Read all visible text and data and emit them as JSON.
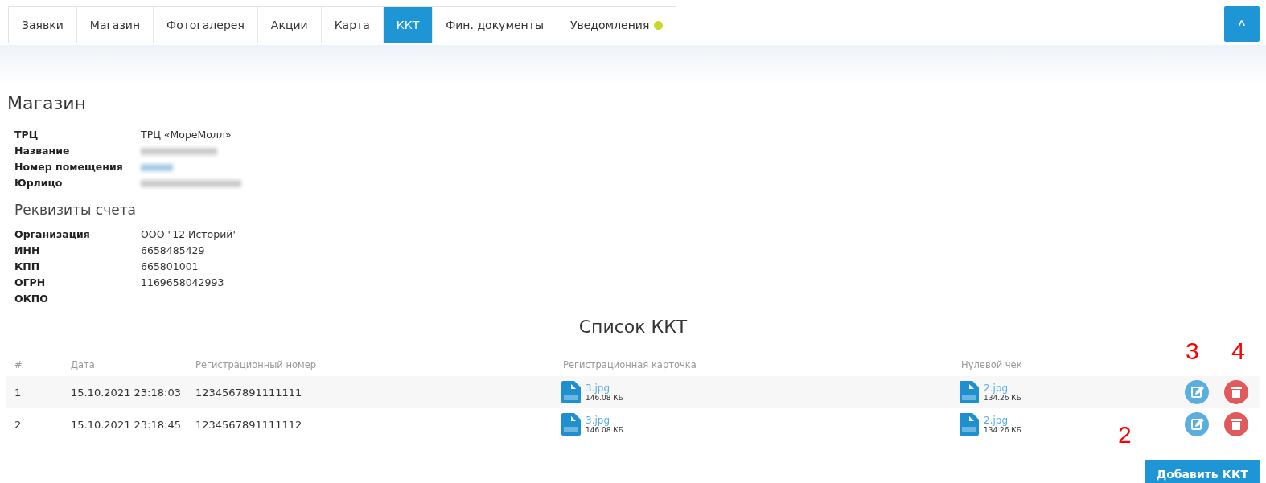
{
  "tabs": [
    {
      "label": "Заявки",
      "selected": false
    },
    {
      "label": "Магазин",
      "selected": false
    },
    {
      "label": "Фотогалерея",
      "selected": false
    },
    {
      "label": "Акции",
      "selected": false
    },
    {
      "label": "Карта",
      "selected": false
    },
    {
      "label": "ККТ",
      "selected": true
    },
    {
      "label": "Фин. документы",
      "selected": false
    },
    {
      "label": "Уведомления",
      "selected": false,
      "color": "#c8d92b"
    }
  ],
  "collapse_button": {
    "label": "^"
  },
  "store": {
    "title": "Магазин",
    "rows": [
      {
        "label": "ТРЦ",
        "kind": "text",
        "value": "ТРЦ «МореМолл»"
      },
      {
        "label": "Название",
        "kind": "redacted"
      },
      {
        "label": "Номер помещения",
        "kind": "redacted_link"
      },
      {
        "label": "Юрлицо",
        "kind": "redacted"
      }
    ]
  },
  "account": {
    "title": "Реквизиты счета",
    "rows": [
      {
        "label": "Организация",
        "kind": "text",
        "value": "ООО \"12 Историй\""
      },
      {
        "label": "ИНН",
        "kind": "text",
        "value": "6658485429"
      },
      {
        "label": "КПП",
        "kind": "text",
        "value": "665801001"
      },
      {
        "label": "ОГРН",
        "kind": "text",
        "value": "1169658042993"
      },
      {
        "label": "ОКПО",
        "kind": "text"
      }
    ]
  },
  "kkt_table": {
    "title": "Список ККТ",
    "columns": [
      "#",
      "Дата",
      "Регистрационный номер",
      "Регистрационная карточка",
      "Нулевой чек"
    ],
    "rows": [
      {
        "index": "1",
        "date": "15.10.2021 23:18:03",
        "reg_number": "1234567891111111",
        "card": {
          "name": "3.jpg",
          "size": "146.08 КБ"
        },
        "zero_check": {
          "name": "2.jpg",
          "size": "134.26 КБ"
        }
      },
      {
        "index": "2",
        "date": "15.10.2021 23:18:45",
        "reg_number": "1234567891111112",
        "card": {
          "name": "3.jpg",
          "size": "146.08 КБ"
        },
        "zero_check": {
          "name": "2.jpg",
          "size": "134.26 КБ"
        }
      }
    ]
  },
  "add_button": {
    "label": "Добавить ККТ"
  },
  "annotations": [
    "3",
    "4",
    "2"
  ]
}
